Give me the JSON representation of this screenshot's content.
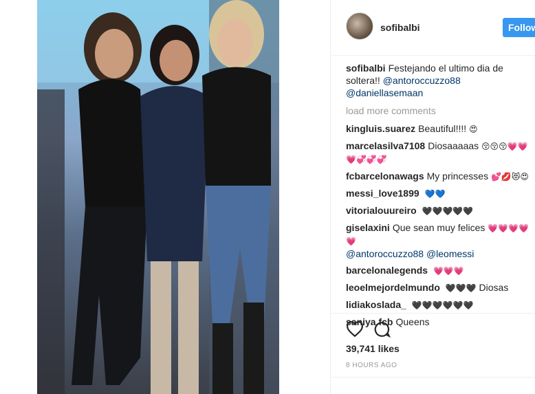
{
  "header": {
    "username": "sofibalbi",
    "follow_label": "Follow"
  },
  "caption": {
    "user": "sofibalbi",
    "text": "Festejando el ultimo dia de soltera!!",
    "mention1": "@antoroccuzzo88",
    "mention2": "@daniellasemaan"
  },
  "load_more": "load more comments",
  "comments": [
    {
      "user": "kingluis.suarez",
      "text": "Beautiful!!!!",
      "emoji": "😍"
    },
    {
      "user": "marcelasilva7108",
      "text": "Diosaaaaas",
      "emoji": "😚😚😚💗💗💗💞💞💞"
    },
    {
      "user": "fcbarcelonawags",
      "text": "My princesses",
      "emoji": "💕💋😻😍"
    },
    {
      "user": "messi_love1899",
      "text": "",
      "emoji": "💙💙"
    },
    {
      "user": "vitorialouureiro",
      "text": "",
      "emoji": "🖤🖤🖤🖤🖤"
    },
    {
      "user": "giselaxini",
      "text": "Que sean muy felices",
      "emoji": "💗💗💗💗💗",
      "mention1": "@antoroccuzzo88",
      "mention2": "@leomessi"
    },
    {
      "user": "barcelonalegends",
      "text": "",
      "emoji": "💗💗💗"
    },
    {
      "user": "leoelmejordelmundo",
      "text": "Diosas",
      "emoji": "🖤🖤🖤"
    },
    {
      "user": "lidiakoslada_",
      "text": "",
      "emoji": "🖤🖤🖤🖤🖤🖤"
    },
    {
      "user": "saniya.fcb",
      "text": "Queens",
      "emoji": ""
    }
  ],
  "likes": "39,741 likes",
  "time": "8 HOURS AGO",
  "icons": {
    "like": "heart-icon",
    "comment": "comment-icon"
  },
  "colors": {
    "follow_button": "#3897f0",
    "mention": "#003569",
    "muted": "#999999"
  }
}
